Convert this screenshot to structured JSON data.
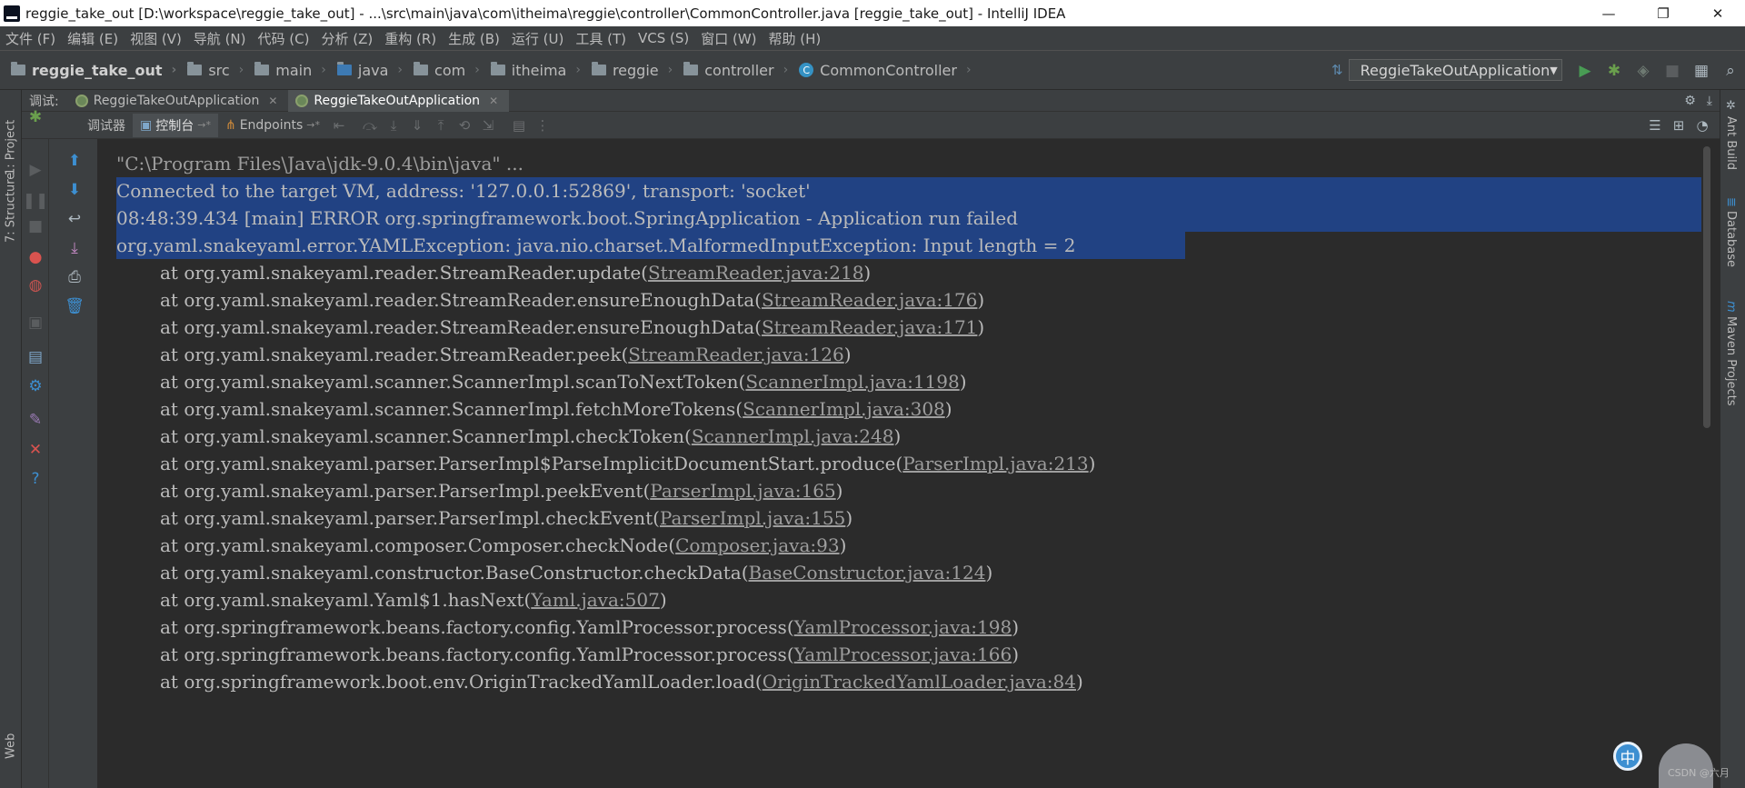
{
  "window": {
    "title": "reggie_take_out [D:\\workspace\\reggie_take_out] - ...\\src\\main\\java\\com\\itheima\\reggie\\controller\\CommonController.java [reggie_take_out] - IntelliJ IDEA",
    "minimize": "—",
    "maximize": "❐",
    "close": "✕"
  },
  "menu": [
    "文件 (F)",
    "编辑 (E)",
    "视图 (V)",
    "导航 (N)",
    "代码 (C)",
    "分析 (Z)",
    "重构 (R)",
    "生成 (B)",
    "运行 (U)",
    "工具 (T)",
    "VCS (S)",
    "窗口 (W)",
    "帮助 (H)"
  ],
  "breadcrumb": {
    "project": "reggie_take_out",
    "items": [
      "src",
      "main",
      "java",
      "com",
      "itheima",
      "reggie",
      "controller"
    ],
    "file": "CommonController",
    "file_icon": "C"
  },
  "run_config": {
    "name": "ReggieTakeOutApplication"
  },
  "debug_panel": {
    "label": "调试:",
    "tabs": [
      "ReggieTakeOutApplication",
      "ReggieTakeOutApplication"
    ],
    "sub_tabs": {
      "debugger": "调试器",
      "console": "控制台",
      "console_suffix": "→*",
      "endpoints": "Endpoints",
      "endpoints_suffix": "→*"
    }
  },
  "left_tool_tabs": [
    "1: Project",
    "7: Structure",
    "Web"
  ],
  "right_tool_tabs": [
    "Ant Build",
    "Database",
    "Maven Projects"
  ],
  "console": {
    "lines": [
      {
        "text": "\"C:\\Program Files\\Java\\jdk-9.0.4\\bin\\java\" ...",
        "link": "",
        "suffix": "",
        "indent": false
      },
      {
        "text": "Connected to the target VM, address: '127.0.0.1:52869', transport: 'socket'",
        "link": "",
        "suffix": "",
        "indent": false
      },
      {
        "text": "08:48:39.434 [main] ERROR org.springframework.boot.SpringApplication - Application run failed",
        "link": "",
        "suffix": "",
        "indent": false
      },
      {
        "text": "org.yaml.snakeyaml.error.YAMLException: java.nio.charset.MalformedInputException: Input length = 2",
        "link": "",
        "suffix": "",
        "indent": false
      },
      {
        "text": "at org.yaml.snakeyaml.reader.StreamReader.update(",
        "link": "StreamReader.java:218",
        "suffix": ")",
        "indent": true
      },
      {
        "text": "at org.yaml.snakeyaml.reader.StreamReader.ensureEnoughData(",
        "link": "StreamReader.java:176",
        "suffix": ")",
        "indent": true
      },
      {
        "text": "at org.yaml.snakeyaml.reader.StreamReader.ensureEnoughData(",
        "link": "StreamReader.java:171",
        "suffix": ")",
        "indent": true
      },
      {
        "text": "at org.yaml.snakeyaml.reader.StreamReader.peek(",
        "link": "StreamReader.java:126",
        "suffix": ")",
        "indent": true
      },
      {
        "text": "at org.yaml.snakeyaml.scanner.ScannerImpl.scanToNextToken(",
        "link": "ScannerImpl.java:1198",
        "suffix": ")",
        "indent": true
      },
      {
        "text": "at org.yaml.snakeyaml.scanner.ScannerImpl.fetchMoreTokens(",
        "link": "ScannerImpl.java:308",
        "suffix": ")",
        "indent": true
      },
      {
        "text": "at org.yaml.snakeyaml.scanner.ScannerImpl.checkToken(",
        "link": "ScannerImpl.java:248",
        "suffix": ")",
        "indent": true
      },
      {
        "text": "at org.yaml.snakeyaml.parser.ParserImpl$ParseImplicitDocumentStart.produce(",
        "link": "ParserImpl.java:213",
        "suffix": ")",
        "indent": true
      },
      {
        "text": "at org.yaml.snakeyaml.parser.ParserImpl.peekEvent(",
        "link": "ParserImpl.java:165",
        "suffix": ")",
        "indent": true
      },
      {
        "text": "at org.yaml.snakeyaml.parser.ParserImpl.checkEvent(",
        "link": "ParserImpl.java:155",
        "suffix": ")",
        "indent": true
      },
      {
        "text": "at org.yaml.snakeyaml.composer.Composer.checkNode(",
        "link": "Composer.java:93",
        "suffix": ")",
        "indent": true
      },
      {
        "text": "at org.yaml.snakeyaml.constructor.BaseConstructor.checkData(",
        "link": "BaseConstructor.java:124",
        "suffix": ")",
        "indent": true
      },
      {
        "text": "at org.yaml.snakeyaml.Yaml$1.hasNext(",
        "link": "Yaml.java:507",
        "suffix": ")",
        "indent": true
      },
      {
        "text": "at org.springframework.beans.factory.config.YamlProcessor.process(",
        "link": "YamlProcessor.java:198",
        "suffix": ")",
        "indent": true
      },
      {
        "text": "at org.springframework.beans.factory.config.YamlProcessor.process(",
        "link": "YamlProcessor.java:166",
        "suffix": ")",
        "indent": true
      },
      {
        "text": "at org.springframework.boot.env.OriginTrackedYamlLoader.load(",
        "link": "OriginTrackedYamlLoader.java:84",
        "suffix": ")",
        "indent": true
      }
    ],
    "selected_lines": [
      1,
      2,
      3
    ]
  },
  "overlay": {
    "ime_label": "中",
    "watermark": "CSDN @六月"
  },
  "colors": {
    "background": "#2b2b2b",
    "panel": "#3c3f41",
    "selection": "#214283",
    "run_green": "#499c54"
  }
}
